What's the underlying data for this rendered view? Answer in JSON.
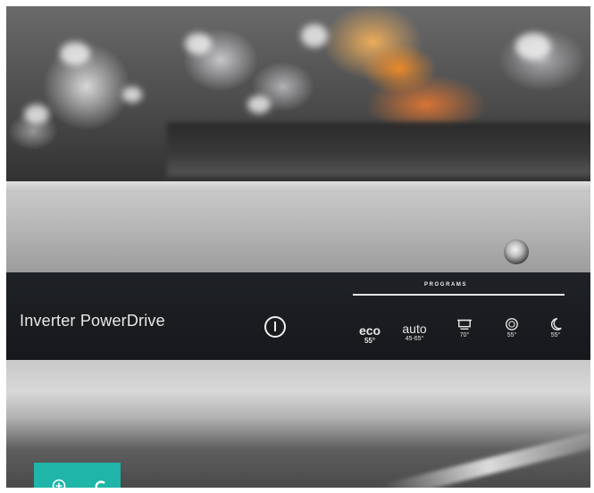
{
  "panel": {
    "brand_text": "Inverter PowerDrive",
    "programs_header": "PROGRAMS",
    "programs": [
      {
        "main": "eco",
        "temp": "55°",
        "icon": "eco-text"
      },
      {
        "main": "auto",
        "temp": "45-65°",
        "icon": "auto-text"
      },
      {
        "main": "",
        "temp": "70°",
        "icon": "pot-icon"
      },
      {
        "main": "",
        "temp": "55°",
        "icon": "plate-icon"
      },
      {
        "main": "",
        "temp": "55°",
        "icon": "moon-icon"
      }
    ]
  },
  "overlay": {
    "icons": [
      "zoom-in-icon",
      "c-icon"
    ],
    "accent_color": "#1fb5a8"
  },
  "colors": {
    "panel_background": "#1a1d20",
    "steel": "#bdbdbd"
  }
}
